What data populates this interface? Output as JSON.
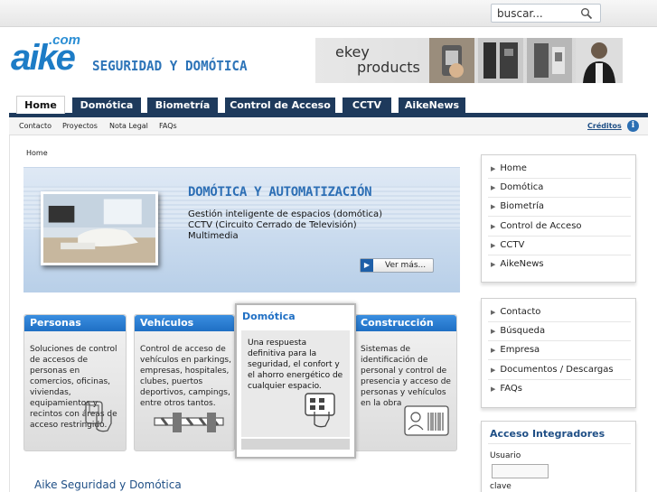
{
  "search": {
    "placeholder": "buscar..."
  },
  "brand": {
    "logo_com": ".com",
    "logo_aike": "aike",
    "tagline": "SEGURIDAD Y DOMÓTICA"
  },
  "ekey": {
    "line1": "ekey",
    "line2": "products"
  },
  "tabs": [
    {
      "label": "Home",
      "active": true
    },
    {
      "label": "Domótica"
    },
    {
      "label": "Biometría"
    },
    {
      "label": "Control de Acceso"
    },
    {
      "label": "CCTV"
    },
    {
      "label": "AikeNews"
    }
  ],
  "subnav": {
    "links": [
      "Contacto",
      "Proyectos",
      "Nota Legal",
      "FAQs"
    ],
    "creditos": "Créditos"
  },
  "breadcrumb": "Home",
  "banner": {
    "title": "DOMÓTICA Y AUTOMATIZACIÓN",
    "lines": [
      "Gestión inteligente de espacios (domótica)",
      "CCTV (Circuito Cerrado de Televisión)",
      "Multimedia"
    ],
    "button": "Ver más..."
  },
  "categories": [
    {
      "title": "Personas",
      "text": "Soluciones de control de accesos de personas en comercios, oficinas, viviendas, equipamientos y recintos con áreas de acceso restringido."
    },
    {
      "title": "Vehículos",
      "text": "Control de acceso de vehículos en parkings, empresas, hospitales, clubes, puertos deportivos, campings, entre otros tantos."
    },
    {
      "title": "Domótica",
      "text": "Una respuesta definitiva para la seguridad, el confort y el ahorro energético de cualquier espacio."
    },
    {
      "title": "Construcción",
      "text": "Sistemas de identificación de personal y control de presencia y acceso de personas y vehículos en la obra"
    }
  ],
  "main_title": "Aike Seguridad y Domótica",
  "right_menu1": [
    "Home",
    "Domótica",
    "Biometría",
    "Control de Acceso",
    "CCTV",
    "AikeNews"
  ],
  "right_menu2": [
    "Contacto",
    "Búsqueda",
    "Empresa",
    "Documentos / Descargas",
    "FAQs"
  ],
  "acceso": {
    "title": "Acceso Integradores",
    "usuario": "Usuario",
    "clave": "clave"
  },
  "colors": {
    "nav": "#1e3a5c",
    "accent": "#1f6fc4",
    "brand": "#1d7cc6"
  }
}
